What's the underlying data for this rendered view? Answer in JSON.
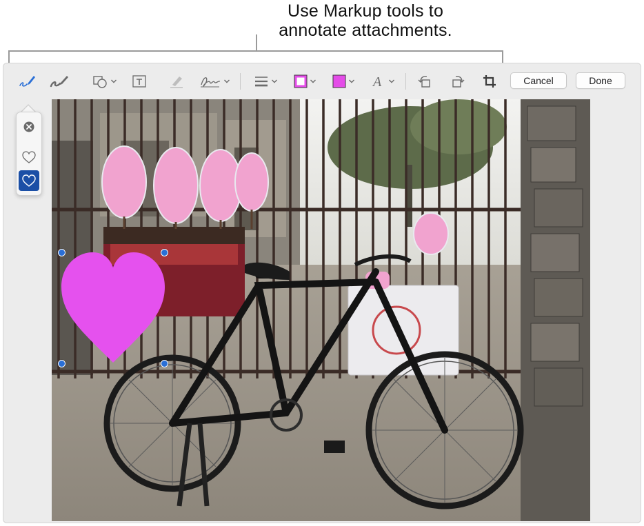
{
  "callout": {
    "line1": "Use Markup tools to",
    "line2": "annotate attachments."
  },
  "toolbar": {
    "tools": [
      {
        "name": "sketch",
        "icon": "sketch-pen-icon",
        "selected": true
      },
      {
        "name": "draw",
        "icon": "draw-brush-icon"
      },
      {
        "name": "shapes",
        "icon": "shapes-icon"
      },
      {
        "name": "text",
        "icon": "text-box-icon"
      },
      {
        "name": "highlight",
        "icon": "highlighter-icon"
      },
      {
        "name": "sign",
        "icon": "signature-icon"
      },
      {
        "name": "shape-style",
        "icon": "line-weight-icon"
      },
      {
        "name": "border-color",
        "icon": "border-color-icon"
      },
      {
        "name": "fill-color",
        "icon": "fill-color-icon"
      },
      {
        "name": "text-style",
        "icon": "text-style-icon"
      },
      {
        "name": "rotate-left",
        "icon": "rotate-left-icon"
      },
      {
        "name": "rotate-right",
        "icon": "rotate-right-icon"
      },
      {
        "name": "crop",
        "icon": "crop-icon"
      }
    ],
    "cancel_label": "Cancel",
    "done_label": "Done"
  },
  "colors": {
    "accent": "#2a6fd6",
    "selected_swatch": "#1b4fa6",
    "border_color": "#6b1f6b",
    "fill_color": "#e44ce8",
    "heart_fill": "#e551ee"
  },
  "popover": {
    "items": [
      {
        "icon": "close-circle-icon"
      },
      {
        "icon": "heart-outline-icon"
      },
      {
        "icon": "heart-filled-icon",
        "selected": true
      }
    ]
  }
}
